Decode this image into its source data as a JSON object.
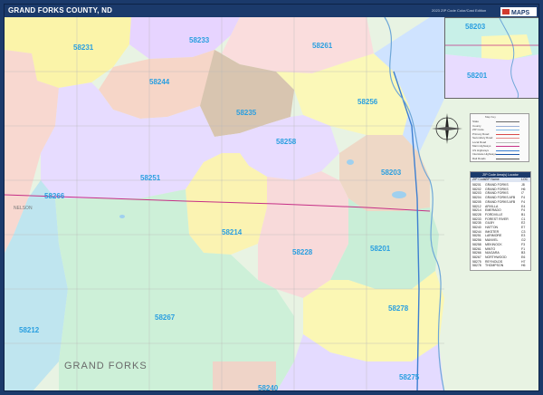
{
  "title": "GRAND FORKS COUNTY, ND",
  "subtitle": "2023 ZIP Code Color/Cast Edition",
  "logo_text": "MAPS",
  "county_label": "GRAND FORKS",
  "place_labels": {
    "nelson": "NELSON"
  },
  "zip_labels": {
    "z58231": "58231",
    "z58233": "58233",
    "z58261": "58261",
    "z58244": "58244",
    "z58256": "58256",
    "z58235": "58235",
    "z58258": "58258",
    "z58203": "58203",
    "z58266": "58266",
    "z58251": "58251",
    "z58214": "58214",
    "z58228": "58228",
    "z58201": "58201",
    "z58212": "58212",
    "z58267": "58267",
    "z58278": "58278",
    "z58275": "58275",
    "z58240": "58240",
    "inset_58203": "58203",
    "inset_58201": "58201"
  },
  "legend": {
    "title": "Map Key",
    "rows": [
      {
        "label": "State",
        "color": "#6b6b6b"
      },
      {
        "label": "County",
        "color": "#9ab0d8"
      },
      {
        "label": "ZIP Code",
        "color": "#7fb8e6"
      },
      {
        "label": "Primary Road",
        "color": "#d94a4a"
      },
      {
        "label": "Secondary Road",
        "color": "#e58a8a"
      },
      {
        "label": "Local Road",
        "color": "#bbbbbb"
      },
      {
        "label": "Main Highways",
        "color": "#c62f86"
      },
      {
        "label": "US Highways",
        "color": "#3d7fd1"
      },
      {
        "label": "Interstate Highways",
        "color": "#1b56a8"
      },
      {
        "label": "Rail Roads",
        "color": "#555555"
      }
    ]
  },
  "zip_table": {
    "title": "ZIP Code Area(s) Locator",
    "headers": [
      "ZIP Code",
      "ZIP Name",
      "LOC"
    ],
    "rows": [
      [
        "58201",
        "GRAND FORKS",
        "J8"
      ],
      [
        "58202",
        "GRAND FORKS",
        "H6"
      ],
      [
        "58203",
        "GRAND FORKS",
        "I7"
      ],
      [
        "58204",
        "GRAND FORKS AFB",
        "F4"
      ],
      [
        "58205",
        "GRAND FORKS AFB",
        "F4"
      ],
      [
        "58212",
        "ARVILLA",
        "E4"
      ],
      [
        "58214",
        "EMERADO",
        "F4"
      ],
      [
        "58228",
        "FORDVILLE",
        "B1"
      ],
      [
        "58233",
        "FOREST RIVER",
        "C1"
      ],
      [
        "58235",
        "GILBY",
        "E2"
      ],
      [
        "58240",
        "HATTON",
        "E7"
      ],
      [
        "58244",
        "INKSTER",
        "C3"
      ],
      [
        "58251",
        "LARIMORE",
        "E3"
      ],
      [
        "58256",
        "MANVEL",
        "G2"
      ],
      [
        "58258",
        "MEKINOCK",
        "F3"
      ],
      [
        "58261",
        "MINTO",
        "F1"
      ],
      [
        "58266",
        "NIAGARA",
        "B3"
      ],
      [
        "58267",
        "NORTHWOOD",
        "E6"
      ],
      [
        "58275",
        "REYNOLDS",
        "H7"
      ],
      [
        "58278",
        "THOMPSON",
        "H6"
      ]
    ]
  }
}
